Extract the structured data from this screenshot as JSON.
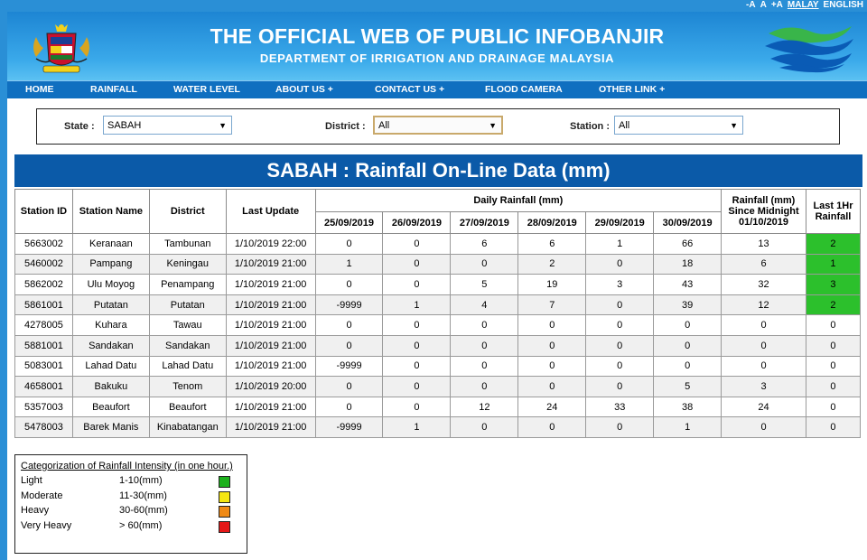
{
  "topbar": {
    "font_small": "-A",
    "font_normal": "A",
    "font_large": "+A",
    "lang_malay": "MALAY",
    "lang_english": "ENGLISH"
  },
  "header": {
    "title": "THE OFFICIAL WEB OF PUBLIC INFOBANJIR",
    "subtitle": "DEPARTMENT OF IRRIGATION AND DRAINAGE MALAYSIA"
  },
  "nav": {
    "home": "HOME",
    "rainfall": "RAINFALL",
    "water_level": "WATER LEVEL",
    "about_us": "ABOUT US  +",
    "contact_us": "CONTACT US  +",
    "flood_camera": "FLOOD CAMERA",
    "other_link": "OTHER LINK  +"
  },
  "filters": {
    "state_label": "State :",
    "state_value": "SABAH",
    "district_label": "District :",
    "district_value": "All",
    "station_label": "Station :",
    "station_value": "All"
  },
  "banner": "SABAH : Rainfall On-Line Data (mm)",
  "table": {
    "headers": {
      "station_id": "Station ID",
      "station_name": "Station Name",
      "district": "District",
      "last_update": "Last Update",
      "daily": "Daily Rainfall (mm)",
      "since_midnight": "Rainfall (mm) Since Midnight 01/10/2019",
      "last_1hr": "Last 1Hr Rainfall"
    },
    "dates": [
      "25/09/2019",
      "26/09/2019",
      "27/09/2019",
      "28/09/2019",
      "29/09/2019",
      "30/09/2019"
    ],
    "rows": [
      {
        "id": "5663002",
        "name": "Keranaan",
        "district": "Tambunan",
        "update": "1/10/2019 22:00",
        "d": [
          "0",
          "0",
          "6",
          "6",
          "1",
          "66"
        ],
        "midnight": "13",
        "hr": "2"
      },
      {
        "id": "5460002",
        "name": "Pampang",
        "district": "Keningau",
        "update": "1/10/2019 21:00",
        "d": [
          "1",
          "0",
          "0",
          "2",
          "0",
          "18"
        ],
        "midnight": "6",
        "hr": "1"
      },
      {
        "id": "5862002",
        "name": "Ulu Moyog",
        "district": "Penampang",
        "update": "1/10/2019 21:00",
        "d": [
          "0",
          "0",
          "5",
          "19",
          "3",
          "43"
        ],
        "midnight": "32",
        "hr": "3"
      },
      {
        "id": "5861001",
        "name": "Putatan",
        "district": "Putatan",
        "update": "1/10/2019 21:00",
        "d": [
          "-9999",
          "1",
          "4",
          "7",
          "0",
          "39"
        ],
        "midnight": "12",
        "hr": "2"
      },
      {
        "id": "4278005",
        "name": "Kuhara",
        "district": "Tawau",
        "update": "1/10/2019 21:00",
        "d": [
          "0",
          "0",
          "0",
          "0",
          "0",
          "0"
        ],
        "midnight": "0",
        "hr": "0"
      },
      {
        "id": "5881001",
        "name": "Sandakan",
        "district": "Sandakan",
        "update": "1/10/2019 21:00",
        "d": [
          "0",
          "0",
          "0",
          "0",
          "0",
          "0"
        ],
        "midnight": "0",
        "hr": "0"
      },
      {
        "id": "5083001",
        "name": "Lahad Datu",
        "district": "Lahad Datu",
        "update": "1/10/2019 21:00",
        "d": [
          "-9999",
          "0",
          "0",
          "0",
          "0",
          "0"
        ],
        "midnight": "0",
        "hr": "0"
      },
      {
        "id": "4658001",
        "name": "Bakuku",
        "district": "Tenom",
        "update": "1/10/2019 20:00",
        "d": [
          "0",
          "0",
          "0",
          "0",
          "0",
          "5"
        ],
        "midnight": "3",
        "hr": "0"
      },
      {
        "id": "5357003",
        "name": "Beaufort",
        "district": "Beaufort",
        "update": "1/10/2019 21:00",
        "d": [
          "0",
          "0",
          "12",
          "24",
          "33",
          "38"
        ],
        "midnight": "24",
        "hr": "0"
      },
      {
        "id": "5478003",
        "name": "Barek Manis",
        "district": "Kinabatangan",
        "update": "1/10/2019 21:00",
        "d": [
          "-9999",
          "1",
          "0",
          "0",
          "0",
          "1"
        ],
        "midnight": "0",
        "hr": "0"
      }
    ]
  },
  "legend": {
    "title": "Categorization of Rainfall Intensity (in one hour.)",
    "items": [
      {
        "name": "Light",
        "range": "1-10(mm)",
        "color": "#1db11d"
      },
      {
        "name": "Moderate",
        "range": "11-30(mm)",
        "color": "#f5e612"
      },
      {
        "name": "Heavy",
        "range": "30-60(mm)",
        "color": "#f08a16"
      },
      {
        "name": "Very Heavy",
        "range": "> 60(mm)",
        "color": "#e51818"
      }
    ]
  },
  "colors": {
    "header_blue": "#2a8fd6",
    "nav_blue": "#0f6fc0",
    "banner_blue": "#0b5aa8",
    "light_rain_green": "#2cc02c"
  }
}
